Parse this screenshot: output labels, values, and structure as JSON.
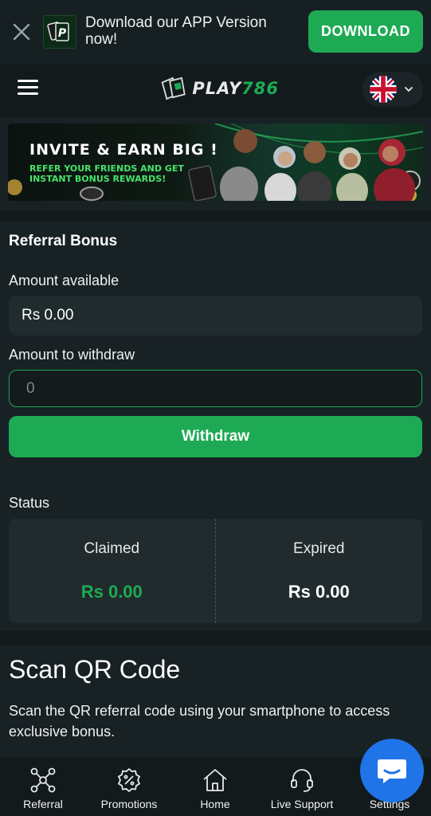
{
  "app_banner": {
    "text": "Download our APP Version now!",
    "download_label": "DOWNLOAD"
  },
  "header": {
    "brand": "PLAY",
    "brand_number": "786",
    "language": "English"
  },
  "promo": {
    "title": "INVITE & EARN BIG !",
    "subtitle": "REFER YOUR FRIENDS AND GET INSTANT BONUS REWARDS!"
  },
  "referral": {
    "title": "Referral Bonus",
    "available_label": "Amount available",
    "available_value": "Rs 0.00",
    "withdraw_label": "Amount to withdraw",
    "withdraw_placeholder": "0",
    "withdraw_button": "Withdraw",
    "status_label": "Status",
    "claimed_label": "Claimed",
    "claimed_value": "Rs 0.00",
    "expired_label": "Expired",
    "expired_value": "Rs 0.00"
  },
  "qr": {
    "title": "Scan QR Code",
    "description": "Scan the QR referral code using your smartphone to access exclusive bonus."
  },
  "bottom_nav": {
    "items": [
      {
        "label": "Referral",
        "icon": "referral-network-icon"
      },
      {
        "label": "Promotions",
        "icon": "promotion-badge-icon"
      },
      {
        "label": "Home",
        "icon": "home-icon"
      },
      {
        "label": "Live Support",
        "icon": "headset-icon"
      },
      {
        "label": "Settings",
        "icon": "settings-icon"
      }
    ]
  },
  "colors": {
    "accent": "#1eaa54",
    "background": "#121a1c",
    "card": "#182124",
    "chat_fab": "#1f74e8"
  }
}
